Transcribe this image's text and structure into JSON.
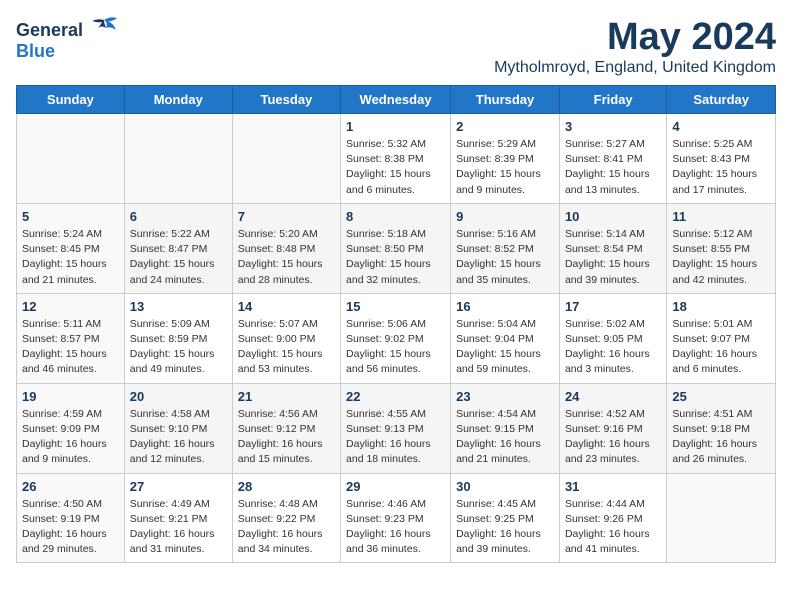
{
  "logo": {
    "general": "General",
    "blue": "Blue"
  },
  "title": {
    "month_year": "May 2024",
    "location": "Mytholmroyd, England, United Kingdom"
  },
  "weekdays": [
    "Sunday",
    "Monday",
    "Tuesday",
    "Wednesday",
    "Thursday",
    "Friday",
    "Saturday"
  ],
  "weeks": [
    [
      {
        "day": "",
        "info": ""
      },
      {
        "day": "",
        "info": ""
      },
      {
        "day": "",
        "info": ""
      },
      {
        "day": "1",
        "info": "Sunrise: 5:32 AM\nSunset: 8:38 PM\nDaylight: 15 hours\nand 6 minutes."
      },
      {
        "day": "2",
        "info": "Sunrise: 5:29 AM\nSunset: 8:39 PM\nDaylight: 15 hours\nand 9 minutes."
      },
      {
        "day": "3",
        "info": "Sunrise: 5:27 AM\nSunset: 8:41 PM\nDaylight: 15 hours\nand 13 minutes."
      },
      {
        "day": "4",
        "info": "Sunrise: 5:25 AM\nSunset: 8:43 PM\nDaylight: 15 hours\nand 17 minutes."
      }
    ],
    [
      {
        "day": "5",
        "info": "Sunrise: 5:24 AM\nSunset: 8:45 PM\nDaylight: 15 hours\nand 21 minutes."
      },
      {
        "day": "6",
        "info": "Sunrise: 5:22 AM\nSunset: 8:47 PM\nDaylight: 15 hours\nand 24 minutes."
      },
      {
        "day": "7",
        "info": "Sunrise: 5:20 AM\nSunset: 8:48 PM\nDaylight: 15 hours\nand 28 minutes."
      },
      {
        "day": "8",
        "info": "Sunrise: 5:18 AM\nSunset: 8:50 PM\nDaylight: 15 hours\nand 32 minutes."
      },
      {
        "day": "9",
        "info": "Sunrise: 5:16 AM\nSunset: 8:52 PM\nDaylight: 15 hours\nand 35 minutes."
      },
      {
        "day": "10",
        "info": "Sunrise: 5:14 AM\nSunset: 8:54 PM\nDaylight: 15 hours\nand 39 minutes."
      },
      {
        "day": "11",
        "info": "Sunrise: 5:12 AM\nSunset: 8:55 PM\nDaylight: 15 hours\nand 42 minutes."
      }
    ],
    [
      {
        "day": "12",
        "info": "Sunrise: 5:11 AM\nSunset: 8:57 PM\nDaylight: 15 hours\nand 46 minutes."
      },
      {
        "day": "13",
        "info": "Sunrise: 5:09 AM\nSunset: 8:59 PM\nDaylight: 15 hours\nand 49 minutes."
      },
      {
        "day": "14",
        "info": "Sunrise: 5:07 AM\nSunset: 9:00 PM\nDaylight: 15 hours\nand 53 minutes."
      },
      {
        "day": "15",
        "info": "Sunrise: 5:06 AM\nSunset: 9:02 PM\nDaylight: 15 hours\nand 56 minutes."
      },
      {
        "day": "16",
        "info": "Sunrise: 5:04 AM\nSunset: 9:04 PM\nDaylight: 15 hours\nand 59 minutes."
      },
      {
        "day": "17",
        "info": "Sunrise: 5:02 AM\nSunset: 9:05 PM\nDaylight: 16 hours\nand 3 minutes."
      },
      {
        "day": "18",
        "info": "Sunrise: 5:01 AM\nSunset: 9:07 PM\nDaylight: 16 hours\nand 6 minutes."
      }
    ],
    [
      {
        "day": "19",
        "info": "Sunrise: 4:59 AM\nSunset: 9:09 PM\nDaylight: 16 hours\nand 9 minutes."
      },
      {
        "day": "20",
        "info": "Sunrise: 4:58 AM\nSunset: 9:10 PM\nDaylight: 16 hours\nand 12 minutes."
      },
      {
        "day": "21",
        "info": "Sunrise: 4:56 AM\nSunset: 9:12 PM\nDaylight: 16 hours\nand 15 minutes."
      },
      {
        "day": "22",
        "info": "Sunrise: 4:55 AM\nSunset: 9:13 PM\nDaylight: 16 hours\nand 18 minutes."
      },
      {
        "day": "23",
        "info": "Sunrise: 4:54 AM\nSunset: 9:15 PM\nDaylight: 16 hours\nand 21 minutes."
      },
      {
        "day": "24",
        "info": "Sunrise: 4:52 AM\nSunset: 9:16 PM\nDaylight: 16 hours\nand 23 minutes."
      },
      {
        "day": "25",
        "info": "Sunrise: 4:51 AM\nSunset: 9:18 PM\nDaylight: 16 hours\nand 26 minutes."
      }
    ],
    [
      {
        "day": "26",
        "info": "Sunrise: 4:50 AM\nSunset: 9:19 PM\nDaylight: 16 hours\nand 29 minutes."
      },
      {
        "day": "27",
        "info": "Sunrise: 4:49 AM\nSunset: 9:21 PM\nDaylight: 16 hours\nand 31 minutes."
      },
      {
        "day": "28",
        "info": "Sunrise: 4:48 AM\nSunset: 9:22 PM\nDaylight: 16 hours\nand 34 minutes."
      },
      {
        "day": "29",
        "info": "Sunrise: 4:46 AM\nSunset: 9:23 PM\nDaylight: 16 hours\nand 36 minutes."
      },
      {
        "day": "30",
        "info": "Sunrise: 4:45 AM\nSunset: 9:25 PM\nDaylight: 16 hours\nand 39 minutes."
      },
      {
        "day": "31",
        "info": "Sunrise: 4:44 AM\nSunset: 9:26 PM\nDaylight: 16 hours\nand 41 minutes."
      },
      {
        "day": "",
        "info": ""
      }
    ]
  ]
}
